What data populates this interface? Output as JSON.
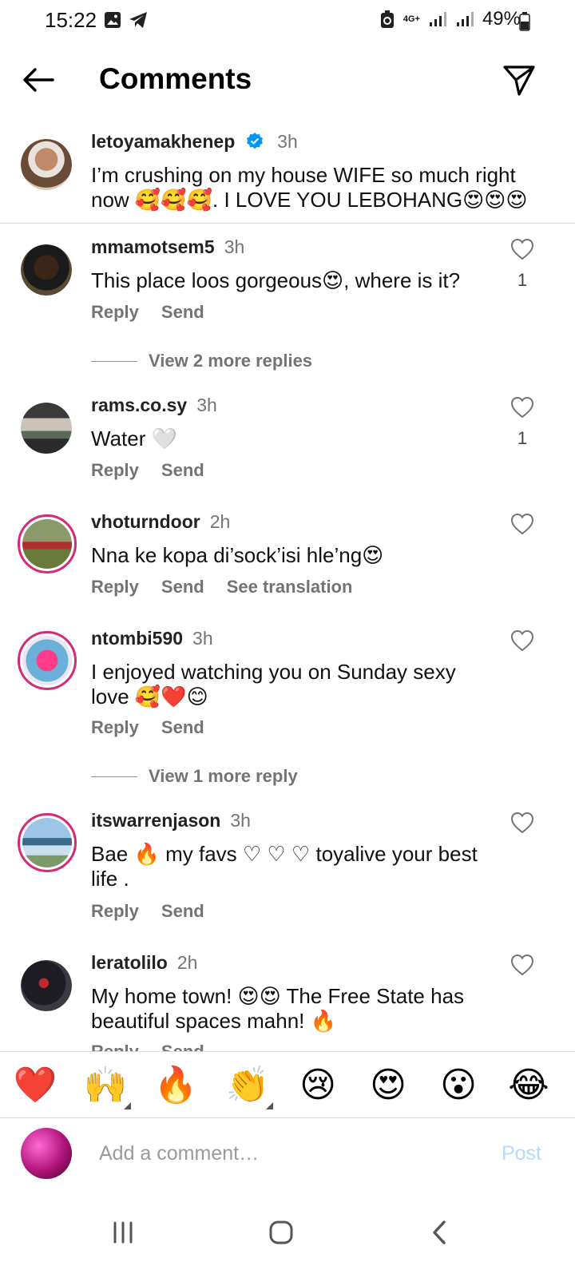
{
  "status_bar": {
    "time": "15:22",
    "network": "4G+",
    "battery": "49%"
  },
  "header": {
    "title": "Comments"
  },
  "caption": {
    "username": "letoyamakhenep",
    "time": "3h",
    "text": "I’m crushing on my house WIFE so much right now 🥰🥰🥰. I LOVE YOU LEBOHANG😍😍😍"
  },
  "comments": [
    {
      "username": "mmamotsem5",
      "time": "3h",
      "text": "This place loos gorgeous😍, where is it?",
      "likes": "1",
      "actions": [
        "Reply",
        "Send"
      ]
    },
    {
      "username": "rams.co.sy",
      "time": "3h",
      "text": "Water 🤍",
      "likes": "1",
      "actions": [
        "Reply",
        "Send"
      ]
    },
    {
      "username": "vhoturndoor",
      "time": "2h",
      "text": "Nna ke kopa di’sock’isi hle’ng😍",
      "likes": "",
      "actions": [
        "Reply",
        "Send",
        "See translation"
      ]
    },
    {
      "username": "ntombi590",
      "time": "3h",
      "text": "I enjoyed watching you on Sunday sexy love 🥰❤️😊",
      "likes": "",
      "actions": [
        "Reply",
        "Send"
      ]
    },
    {
      "username": "itswarrenjason",
      "time": "3h",
      "text": "Bae 🔥 my favs ♡ ♡ ♡ toyalive your best life .",
      "likes": "",
      "actions": [
        "Reply",
        "Send"
      ]
    },
    {
      "username": "leratolilo",
      "time": "2h",
      "text": "My home town! 😍😍 The Free State has beautiful spaces mahn! 🔥",
      "likes": "",
      "actions": [
        "Reply",
        "Send"
      ]
    }
  ],
  "view_more": [
    {
      "label": "View 2 more replies"
    },
    {
      "label": "View 1 more reply"
    }
  ],
  "emoji_bar": [
    "❤️",
    "🙌",
    "🔥",
    "👏",
    "😢",
    "😍",
    "😮",
    "😂"
  ],
  "composer": {
    "placeholder": "Add a comment…",
    "post_label": "Post"
  },
  "colors": {
    "verified": "#0095f6",
    "story_ring": "#d62976",
    "post_disabled": "#b3dbff",
    "meta_gray": "#737373"
  }
}
